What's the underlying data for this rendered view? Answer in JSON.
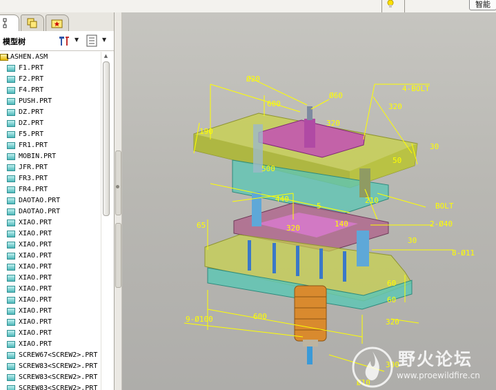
{
  "topbar": {
    "smart_label": "智能"
  },
  "model_tree": {
    "title": "模型树",
    "items": [
      {
        "label": "LASHEN.ASM",
        "kind": "assembly"
      },
      {
        "label": "F1.PRT",
        "kind": "part"
      },
      {
        "label": "F2.PRT",
        "kind": "part"
      },
      {
        "label": "F4.PRT",
        "kind": "part"
      },
      {
        "label": "PUSH.PRT",
        "kind": "part"
      },
      {
        "label": "DZ.PRT",
        "kind": "part"
      },
      {
        "label": "DZ.PRT",
        "kind": "part"
      },
      {
        "label": "F5.PRT",
        "kind": "part"
      },
      {
        "label": "FR1.PRT",
        "kind": "part"
      },
      {
        "label": "MOBIN.PRT",
        "kind": "part"
      },
      {
        "label": "JFR.PRT",
        "kind": "part"
      },
      {
        "label": "FR3.PRT",
        "kind": "part"
      },
      {
        "label": "FR4.PRT",
        "kind": "part"
      },
      {
        "label": "DAOTAO.PRT",
        "kind": "part"
      },
      {
        "label": "DAOTAO.PRT",
        "kind": "part"
      },
      {
        "label": "XIAO.PRT",
        "kind": "part"
      },
      {
        "label": "XIAO.PRT",
        "kind": "part"
      },
      {
        "label": "XIAO.PRT",
        "kind": "part"
      },
      {
        "label": "XIAO.PRT",
        "kind": "part"
      },
      {
        "label": "XIAO.PRT",
        "kind": "part"
      },
      {
        "label": "XIAO.PRT",
        "kind": "part"
      },
      {
        "label": "XIAO.PRT",
        "kind": "part"
      },
      {
        "label": "XIAO.PRT",
        "kind": "part"
      },
      {
        "label": "XIAO.PRT",
        "kind": "part"
      },
      {
        "label": "XIAO.PRT",
        "kind": "part"
      },
      {
        "label": "XIAO.PRT",
        "kind": "part"
      },
      {
        "label": "XIAO.PRT",
        "kind": "part"
      },
      {
        "label": "SCREW67<SCREW2>.PRT",
        "kind": "part"
      },
      {
        "label": "SCREW83<SCREW2>.PRT",
        "kind": "part"
      },
      {
        "label": "SCREW83<SCREW2>.PRT",
        "kind": "part"
      },
      {
        "label": "SCREW83<SCREW2>.PRT",
        "kind": "part"
      }
    ]
  },
  "viewport": {
    "dimensions": [
      "Ø20",
      "Ø60",
      "4-BOLT",
      "600",
      "320",
      "30",
      "190",
      "320",
      "500",
      "50",
      "440",
      "5",
      "210",
      "BOLT",
      "65",
      "2-Ø40",
      "320",
      "140",
      "30",
      "8-Ø11",
      "60",
      "60",
      "600",
      "9-Ø100",
      "320",
      "300",
      "Ø10"
    ],
    "colors": {
      "dim": "#ffff00",
      "yellow_plate": "#c9d34a",
      "cyan_plate": "#5fc6b4",
      "magenta": "#c24fb4",
      "orange": "#d98a2e",
      "blue_pin": "#5ea8d8"
    }
  },
  "watermark": {
    "title": "野火论坛",
    "url": "www.proewildfire.cn"
  }
}
